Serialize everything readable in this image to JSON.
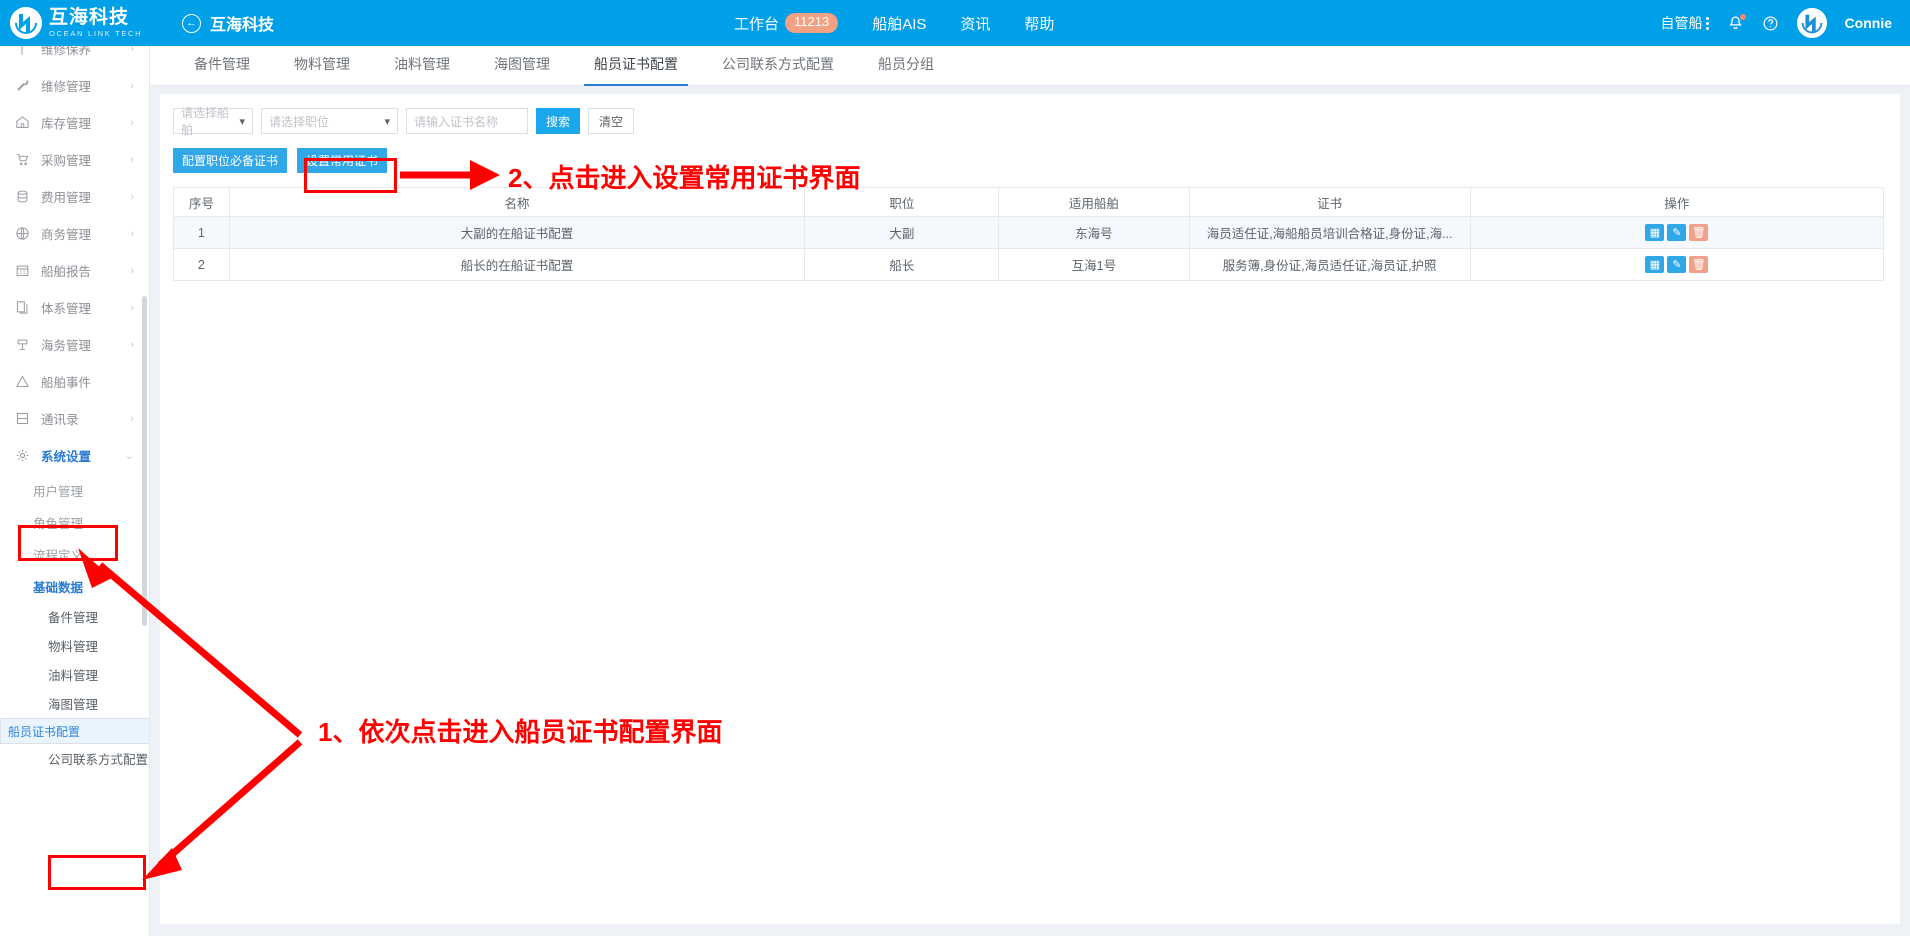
{
  "header": {
    "brand_cn": "互海科技",
    "brand_en": "OCEAN LINK TECH",
    "back_icon": "back-arrow-circle-icon",
    "back_label": "互海科技",
    "nav": [
      {
        "label": "工作台",
        "badge": "11213"
      },
      {
        "label": "船舶AIS",
        "badge": ""
      },
      {
        "label": "资讯",
        "badge": ""
      },
      {
        "label": "帮助",
        "badge": ""
      }
    ],
    "fleet_selector": "自管船",
    "kebab_icon": "kebab-menu-icon",
    "bell_icon": "notification-bell-icon",
    "help_icon": "help-circle-icon",
    "avatar_icon": "user-avatar-icon",
    "username": "Connie"
  },
  "sidebar": {
    "items": [
      {
        "label": "维修保养",
        "icon": "wrench-screwdriver-icon",
        "arrow": "›"
      },
      {
        "label": "维修管理",
        "icon": "wrench-icon",
        "arrow": "›"
      },
      {
        "label": "库存管理",
        "icon": "warehouse-icon",
        "arrow": "›"
      },
      {
        "label": "采购管理",
        "icon": "shopping-cart-icon",
        "arrow": "›"
      },
      {
        "label": "费用管理",
        "icon": "database-icon",
        "arrow": "›"
      },
      {
        "label": "商务管理",
        "icon": "globe-icon",
        "arrow": "›"
      },
      {
        "label": "船舶报告",
        "icon": "calendar-icon",
        "arrow": "›"
      },
      {
        "label": "体系管理",
        "icon": "documents-icon",
        "arrow": "›"
      },
      {
        "label": "海务管理",
        "icon": "anchor-icon",
        "arrow": "›"
      },
      {
        "label": "船舶事件",
        "icon": "warning-triangle-icon",
        "arrow": ""
      },
      {
        "label": "通讯录",
        "icon": "contacts-icon",
        "arrow": "›"
      }
    ],
    "system_settings": {
      "label": "系统设置",
      "icon": "gear-icon",
      "arrow": "⌄"
    },
    "sub_items": [
      {
        "label": "用户管理"
      },
      {
        "label": "角色管理"
      },
      {
        "label": "流程定义"
      }
    ],
    "basic_data": {
      "label": "基础数据",
      "arrow": "⌄"
    },
    "basic_children": [
      {
        "label": "备件管理",
        "selected": false
      },
      {
        "label": "物料管理",
        "selected": false
      },
      {
        "label": "油料管理",
        "selected": false
      },
      {
        "label": "海图管理",
        "selected": false
      },
      {
        "label": "船员证书配置",
        "selected": true
      },
      {
        "label": "公司联系方式配置",
        "selected": false
      }
    ]
  },
  "main": {
    "tabs": [
      {
        "label": "备件管理",
        "active": false
      },
      {
        "label": "物料管理",
        "active": false
      },
      {
        "label": "油料管理",
        "active": false
      },
      {
        "label": "海图管理",
        "active": false
      },
      {
        "label": "船员证书配置",
        "active": true
      },
      {
        "label": "公司联系方式配置",
        "active": false
      },
      {
        "label": "船员分组",
        "active": false
      }
    ],
    "filters": {
      "ship_select": "请选择船舶",
      "position_select": "请选择职位",
      "cert_name_placeholder": "请输入证书名称",
      "cert_name_value": "",
      "search_label": "搜索",
      "clear_label": "清空",
      "caret_icon": "chevron-down-icon"
    },
    "actions": {
      "config_required_cert": "配置职位必备证书",
      "set_common_cert": "设置常用证书"
    },
    "table": {
      "columns": [
        "序号",
        "名称",
        "职位",
        "适用船舶",
        "证书",
        "操作"
      ],
      "rows": [
        {
          "index": "1",
          "name": "大副的在船证书配置",
          "position": "大副",
          "ship": "东海号",
          "certs": "海员适任证,海船船员培训合格证,身份证,海...",
          "actions": [
            "view-icon",
            "edit-icon",
            "delete-icon"
          ]
        },
        {
          "index": "2",
          "name": "船长的在船证书配置",
          "position": "船长",
          "ship": "互海1号",
          "certs": "服务簿,身份证,海员适任证,海员证,护照",
          "actions": [
            "view-icon",
            "edit-icon",
            "delete-icon"
          ]
        }
      ],
      "action_icons": {
        "view": "▤",
        "edit": "✎",
        "delete": "🗑"
      }
    }
  },
  "annotations": {
    "color": "#ff0000",
    "step1": "1、依次点击进入船员证书配置界面",
    "step2": "2、点击进入设置常用证书界面"
  }
}
